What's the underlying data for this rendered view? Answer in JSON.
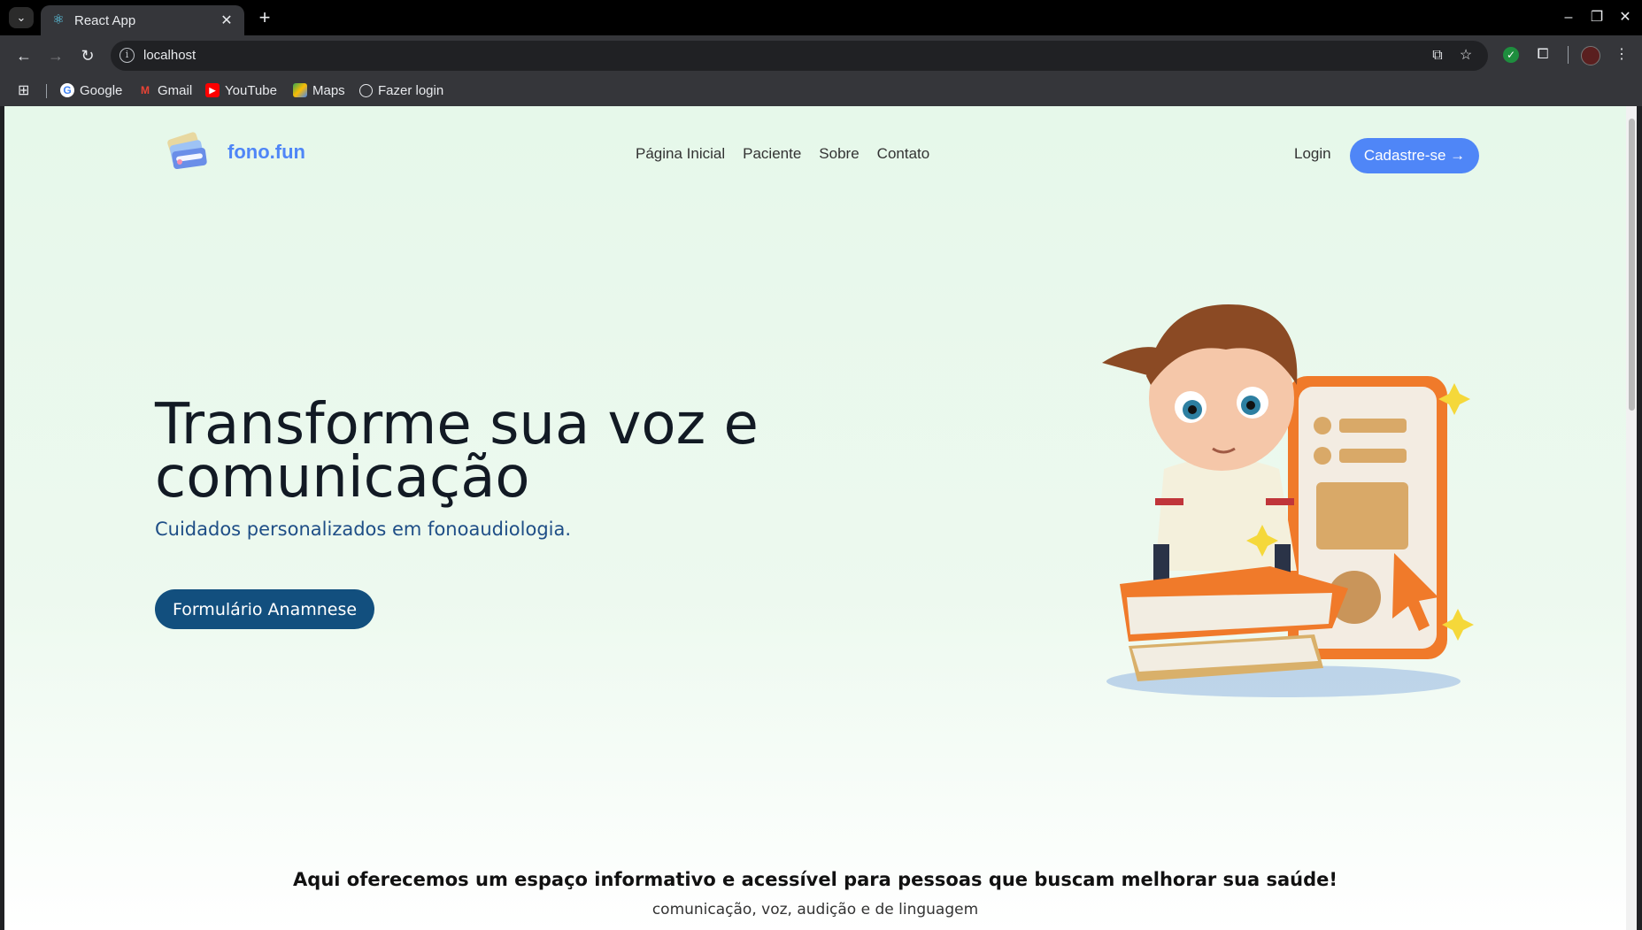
{
  "browser": {
    "tab_title": "React App",
    "url": "localhost",
    "bookmarks": [
      {
        "label": "Google",
        "icon": "google-icon"
      },
      {
        "label": "Gmail",
        "icon": "gmail-icon"
      },
      {
        "label": "YouTube",
        "icon": "youtube-icon"
      },
      {
        "label": "Maps",
        "icon": "maps-icon"
      },
      {
        "label": "Fazer login",
        "icon": "globe-icon"
      }
    ]
  },
  "site": {
    "logo_text": "fono.fun",
    "nav": [
      "Página Inicial",
      "Paciente",
      "Sobre",
      "Contato"
    ],
    "login_label": "Login",
    "signup_label": "Cadastre-se →"
  },
  "hero": {
    "title": "Transforme sua voz e comunicação",
    "subtitle": "Cuidados personalizados em fonoaudiologia.",
    "cta_label": "Formulário Anamnese"
  },
  "info": {
    "heading": "Aqui oferecemos um espaço informativo e acessível para pessoas que buscam melhorar sua saúde!",
    "subheading": "comunicação, voz, audição e de linguagem"
  },
  "colors": {
    "brand": "#4f86f7",
    "primary_dark": "#124f7e",
    "page_bg": "#e6f8ea"
  }
}
